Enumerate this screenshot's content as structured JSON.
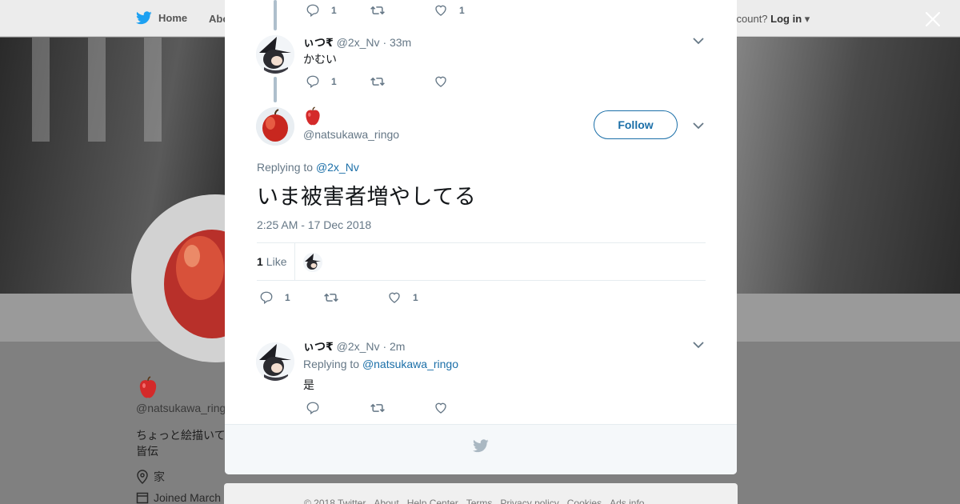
{
  "topbar": {
    "home_label": "Home",
    "about_label": "Abo",
    "account_text": "ccount?",
    "login_label": "Log in"
  },
  "profile": {
    "emoji": "🍎",
    "handle": "@natsukawa_ringo",
    "bio": "ちょっと絵描いて 皆伝",
    "location": "家",
    "joined": "Joined March"
  },
  "thread": {
    "top_actions": {
      "reply_count": "1",
      "retweet_count": "",
      "like_count": "1"
    },
    "tweet1": {
      "name": "ぃつ₹",
      "handle": "@2x_Nv",
      "time": "· 33m",
      "text": "かむい",
      "reply_count": "1",
      "retweet_count": "",
      "like_count": ""
    },
    "main": {
      "name_emoji": "🍎",
      "handle": "@natsukawa_ringo",
      "follow_label": "Follow",
      "replying_prefix": "Replying to",
      "replying_handle": "@2x_Nv",
      "text": "いま被害者増やしてる",
      "timestamp": "2:25 AM - 17 Dec 2018",
      "likes_count": "1",
      "likes_label": "Like",
      "reply_count": "1",
      "retweet_count": "",
      "like_count": "1"
    },
    "tweet2": {
      "name": "ぃつ₹",
      "handle": "@2x_Nv",
      "time": "· 2m",
      "replying_prefix": "Replying to",
      "replying_handle": "@natsukawa_ringo",
      "text": "是"
    }
  },
  "footer": {
    "links": [
      "© 2018 Twitter",
      "About",
      "Help Center",
      "Terms",
      "Privacy policy",
      "Cookies",
      "Ads info"
    ]
  },
  "colors": {
    "accent": "#1b6fa8",
    "thread_line": "#aebfcc",
    "muted_text": "#657786",
    "twitter_blue": "#1da1f2"
  },
  "icons": {
    "logo": "twitter-bird-icon",
    "close": "close-icon",
    "reply": "reply-icon",
    "retweet": "retweet-icon",
    "like": "heart-icon",
    "caret": "chevron-down-icon",
    "location": "location-pin-icon",
    "calendar": "calendar-icon"
  }
}
